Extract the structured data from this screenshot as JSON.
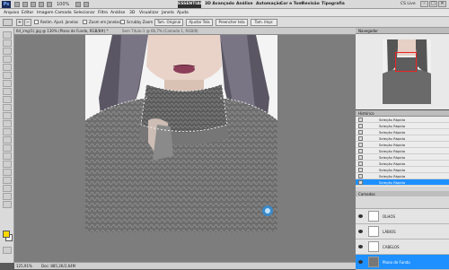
{
  "app": {
    "logo": "Ps",
    "zoom": "100%",
    "workspaces": [
      "ESSENTIALS",
      "3D Avançado",
      "Análise",
      "Automação",
      "Cor e Tom",
      "Revisão",
      "Tipografia"
    ],
    "active_workspace": "ESSENTIALS",
    "cs_live": "CS Live",
    "accent": "#1e90ff"
  },
  "menu": [
    "Arquivo",
    "Editar",
    "Imagem",
    "Camada",
    "Selecionar",
    "Filtro",
    "Análise",
    "3D",
    "Visualizar",
    "Janela",
    "Ajuda"
  ],
  "options": {
    "resize_windows": "Redim. Ajust. Janelas",
    "zoom_all": "Zoom em Janelas",
    "scrubby_zoom": "Scrubby Zoom",
    "actual_pixels": "Tam. Original",
    "fit_screen": "Ajustar Tela",
    "fill_screen": "Preencher tela",
    "print_size": "Tam. Impr."
  },
  "document": {
    "tab": "64_img(1).jpg @ 130% (Plano de Fundo, RGB/8#) *",
    "title_hint": "Sem Título-1 @ 66,7% (Camada 1, RGB/8)",
    "status_zoom": "125,91%",
    "status_doc": "Doc: 885,2K/2,64M"
  },
  "panels": {
    "navigator_title": "Navegador",
    "history_title": "Histórico",
    "history_items": [
      "Seleção Rápida",
      "Seleção Rápida",
      "Seleção Rápida",
      "Seleção Rápida",
      "Seleção Rápida",
      "Seleção Rápida",
      "Seleção Rápida",
      "Seleção Rápida",
      "Seleção Rápida",
      "Seleção Rápida",
      "Seleção Rápida"
    ],
    "layers_title": "Camadas",
    "layers": [
      "OLHOS",
      "LÁBIOS",
      "CABELOS",
      "Plano de Fundo"
    ]
  }
}
